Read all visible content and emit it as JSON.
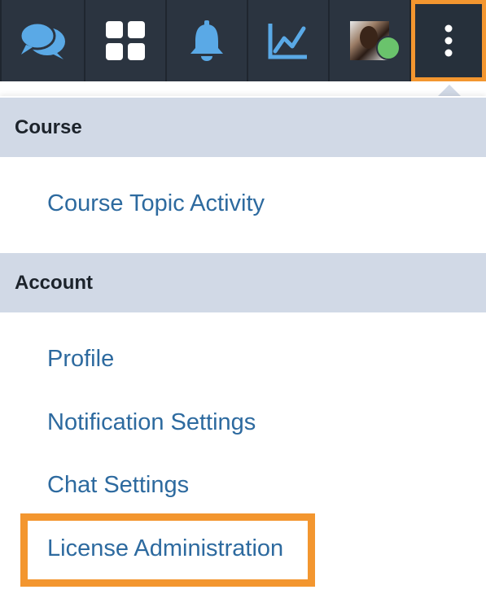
{
  "toolbar": {
    "items": [
      {
        "name": "chat",
        "icon": "chat-bubbles-icon"
      },
      {
        "name": "apps",
        "icon": "grid-icon"
      },
      {
        "name": "notifications",
        "icon": "bell-icon"
      },
      {
        "name": "activity",
        "icon": "line-chart-icon"
      },
      {
        "name": "profile",
        "icon": "avatar",
        "status": "online"
      },
      {
        "name": "more",
        "icon": "vertical-ellipsis-icon"
      }
    ],
    "colors": {
      "bar": "#2b3440",
      "icon": "#5aa9e6",
      "icon_white": "#ffffff",
      "highlight": "#f3962f",
      "online": "#6ac36c"
    }
  },
  "menu": {
    "sections": [
      {
        "title": "Course",
        "items": [
          "Course Topic Activity"
        ]
      },
      {
        "title": "Account",
        "items": [
          "Profile",
          "Notification Settings",
          "Chat Settings",
          "License Administration"
        ]
      }
    ]
  }
}
